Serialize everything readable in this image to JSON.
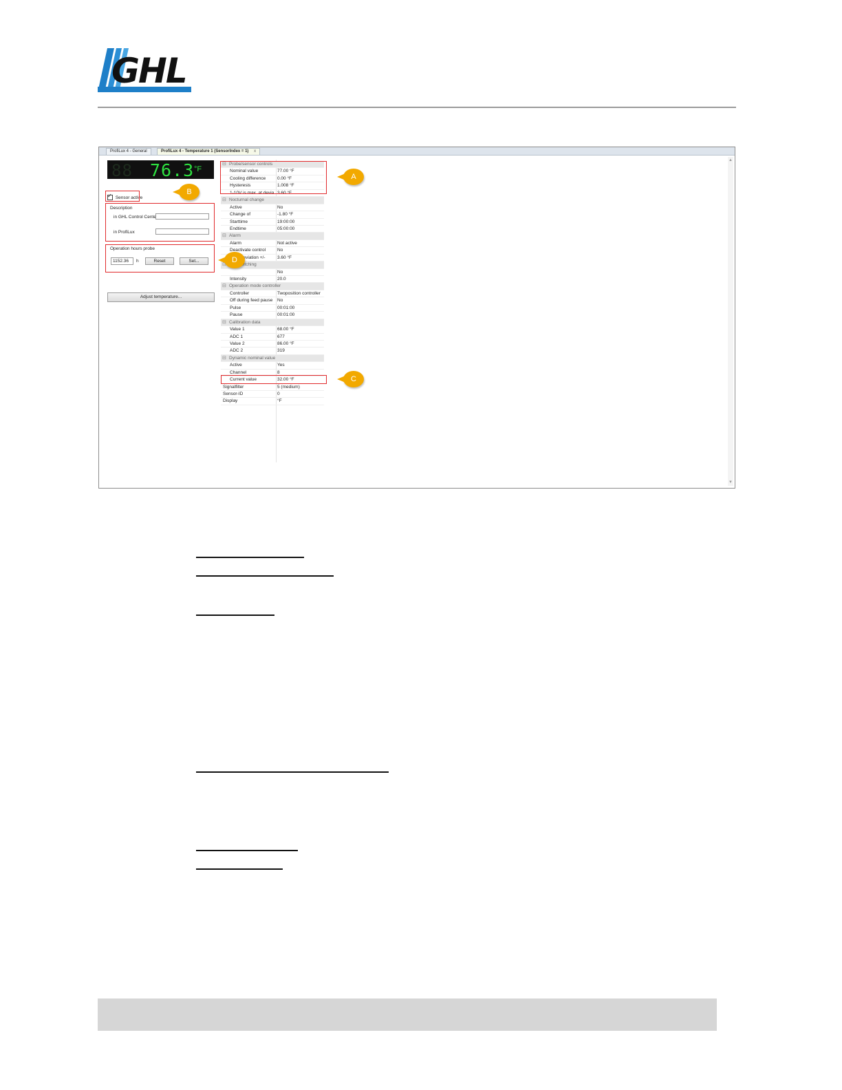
{
  "logo": {
    "text": "GHL"
  },
  "screenshot": {
    "tabs": [
      {
        "label": "ProfiLux 4 - General"
      },
      {
        "label": "ProfiLux 4 - Temperature 1 (SensorIndex = 1)",
        "close": "x"
      }
    ],
    "display": {
      "ghost": "88",
      "value": "76.3",
      "unit": "°F",
      "color": "#2ee040"
    },
    "sensor_active_label": "Sensor active",
    "description_label": "Description",
    "in_ghl_label": "in GHL Control Center",
    "in_profilux_label": "in ProfiLux",
    "operation_hours_label": "Operation hours probe",
    "hours_value": "1152.36",
    "hours_unit": "h",
    "reset_label": "Reset",
    "set_label": "Set...",
    "adjust_label": "Adjust temperature...",
    "callouts": {
      "a": "A",
      "b": "B",
      "c": "C",
      "d": "D"
    },
    "property_grid": [
      {
        "type": "cat",
        "name": "Probe/sensor controls"
      },
      {
        "type": "row",
        "name": "Nominal value",
        "value": "77.00 °F"
      },
      {
        "type": "row",
        "name": "Cooling difference",
        "value": "0.00 °F"
      },
      {
        "type": "row",
        "name": "Hysteresis",
        "value": "1.008 °F"
      },
      {
        "type": "row",
        "name": "1-10V is max. at devia...",
        "value": "3.60 °F"
      },
      {
        "type": "cat",
        "name": "Nocturnal change"
      },
      {
        "type": "row",
        "name": "Active",
        "value": "No"
      },
      {
        "type": "row",
        "name": "Change of",
        "value": "-1.80 °F"
      },
      {
        "type": "row",
        "name": "Starttime",
        "value": "19:00:00"
      },
      {
        "type": "row",
        "name": "Endtime",
        "value": "05:00:00"
      },
      {
        "type": "cat",
        "name": "Alarm"
      },
      {
        "type": "row",
        "name": "Alarm",
        "value": "Not active"
      },
      {
        "type": "row",
        "name": "Deactivate control",
        "value": "No"
      },
      {
        "type": "row",
        "name": "Max. deviation +/-",
        "value": "3.60 °F"
      },
      {
        "type": "cat",
        "name": "...er switching"
      },
      {
        "type": "row",
        "name": "",
        "value": "No"
      },
      {
        "type": "row",
        "name": "Intensity",
        "value": "20.0"
      },
      {
        "type": "cat",
        "name": "Operation mode controller"
      },
      {
        "type": "row",
        "name": "Controller",
        "value": "Twoposition controller"
      },
      {
        "type": "row",
        "name": "Off during feed pause",
        "value": "No"
      },
      {
        "type": "row",
        "name": "Pulse",
        "value": "00:01:00"
      },
      {
        "type": "row",
        "name": "Pause",
        "value": "00:01:00"
      },
      {
        "type": "cat",
        "name": "Calibration data"
      },
      {
        "type": "row",
        "name": "Value 1",
        "value": "68.00 °F"
      },
      {
        "type": "row",
        "name": "ADC 1",
        "value": "677"
      },
      {
        "type": "row",
        "name": "Value 2",
        "value": "86.00 °F"
      },
      {
        "type": "row",
        "name": "ADC 2",
        "value": "319"
      },
      {
        "type": "cat",
        "name": "Dynamic nominal value"
      },
      {
        "type": "row",
        "name": "Active",
        "value": "Yes"
      },
      {
        "type": "row",
        "name": "Channel",
        "value": "8"
      },
      {
        "type": "row",
        "name": "Current value",
        "value": "32.00 °F"
      },
      {
        "type": "top",
        "name": "Signalfilter",
        "value": "5 (medium)"
      },
      {
        "type": "top",
        "name": "Sensor-ID",
        "value": "0"
      },
      {
        "type": "top",
        "name": "Display",
        "value": "°F"
      }
    ]
  },
  "colors": {
    "callout": "#f2a900",
    "highlight_box": "#e0282a",
    "footer_bar": "#d6d6d6"
  }
}
